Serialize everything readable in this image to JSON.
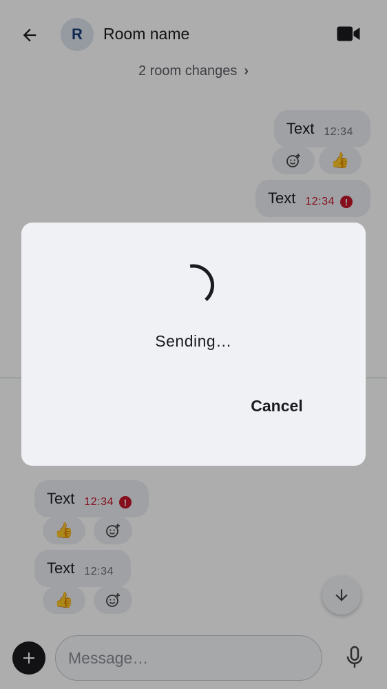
{
  "header": {
    "room_name": "Room name",
    "avatar_letter": "R",
    "back_icon": "arrow-left-icon",
    "video_icon": "video-call-icon"
  },
  "timeline": {
    "room_changes": "2 room changes",
    "messages": [
      {
        "text": "Text",
        "time": "12:34",
        "direction": "outgoing",
        "status": "sent"
      },
      {
        "text": "Text",
        "time": "12:34",
        "direction": "outgoing",
        "status": "error"
      },
      {
        "text": "Text",
        "time": "12:34",
        "direction": "incoming",
        "status": "error"
      },
      {
        "text": "Text",
        "time": "12:34",
        "direction": "incoming",
        "status": "sent"
      }
    ],
    "reaction_emoji": "👍",
    "add_reaction_icon": "add-reaction-icon",
    "error_mark": "!"
  },
  "composer": {
    "placeholder": "Message…",
    "add_icon": "plus-icon",
    "mic_icon": "microphone-icon"
  },
  "dialog": {
    "message": "Sending…",
    "cancel_label": "Cancel"
  },
  "colors": {
    "error": "#c4162a",
    "bubble": "#eceef3",
    "dialog": "#f0f1f5",
    "scrim": "rgba(0,0,0,0.32)"
  }
}
